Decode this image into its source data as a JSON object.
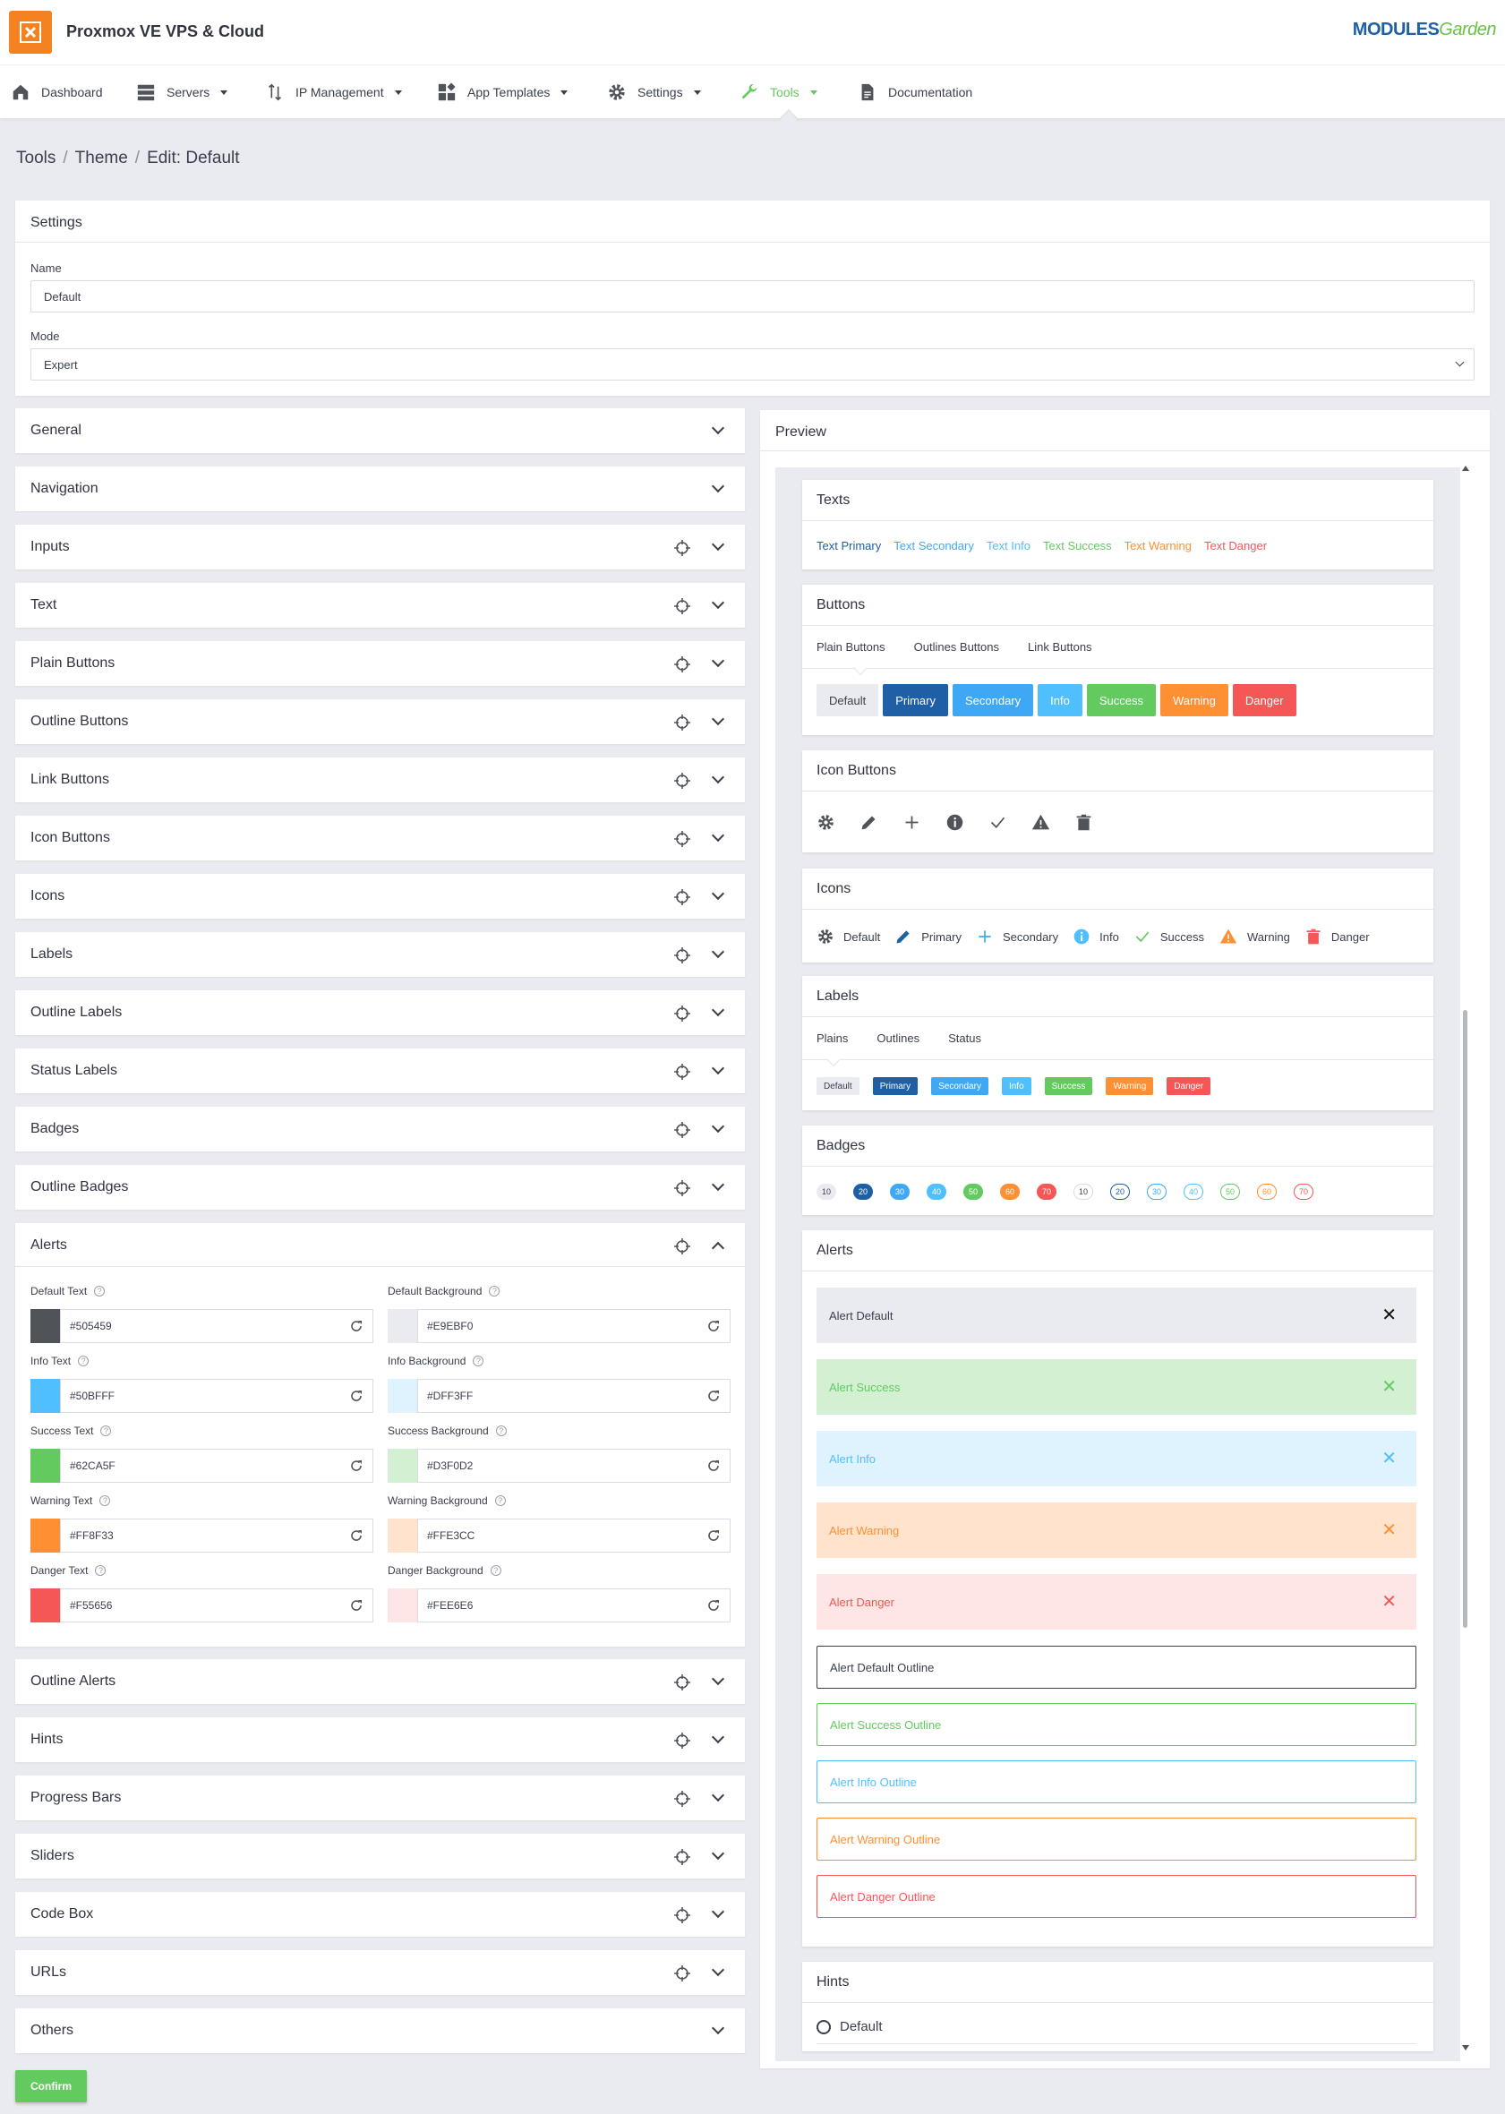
{
  "app": {
    "title": "Proxmox VE VPS & Cloud",
    "brand_a": "MODULES",
    "brand_b": "Garden"
  },
  "nav": [
    {
      "label": "Dashboard",
      "icon": "home-icon"
    },
    {
      "label": "Servers",
      "icon": "servers-icon"
    },
    {
      "label": "IP Management",
      "icon": "ip-arrows-icon"
    },
    {
      "label": "App Templates",
      "icon": "app-templates-icon"
    },
    {
      "label": "Settings",
      "icon": "gear-icon"
    },
    {
      "label": "Tools",
      "icon": "wrench-icon",
      "active": true
    },
    {
      "label": "Documentation",
      "icon": "document-icon"
    }
  ],
  "breadcrumb": [
    "Tools",
    "Theme",
    "Edit: Default"
  ],
  "settings": {
    "title": "Settings",
    "name_label": "Name",
    "name_value": "Default",
    "mode_label": "Mode",
    "mode_value": "Expert"
  },
  "sections": [
    "General",
    "Navigation",
    "Inputs",
    "Text",
    "Plain Buttons",
    "Outline Buttons",
    "Link Buttons",
    "Icon Buttons",
    "Icons",
    "Labels",
    "Outline Labels",
    "Status Labels",
    "Badges",
    "Outline Badges",
    "Alerts",
    "Outline Alerts",
    "Hints",
    "Progress Bars",
    "Sliders",
    "Code Box",
    "URLs",
    "Others"
  ],
  "alert_colors": [
    {
      "label": "Default Text",
      "value": "#505459"
    },
    {
      "label": "Default Background",
      "value": "#E9EBF0"
    },
    {
      "label": "Info Text",
      "value": "#50BFFF"
    },
    {
      "label": "Info Background",
      "value": "#DFF3FF"
    },
    {
      "label": "Success Text",
      "value": "#62CA5F"
    },
    {
      "label": "Success Background",
      "value": "#D3F0D2"
    },
    {
      "label": "Warning Text",
      "value": "#FF8F33"
    },
    {
      "label": "Warning Background",
      "value": "#FFE3CC"
    },
    {
      "label": "Danger Text",
      "value": "#F55656"
    },
    {
      "label": "Danger Background",
      "value": "#FEE6E6"
    }
  ],
  "preview": {
    "title": "Preview",
    "texts_title": "Texts",
    "texts": [
      "Text Primary",
      "Text Secondary",
      "Text Info",
      "Text Success",
      "Text Warning",
      "Text Danger"
    ],
    "buttons_title": "Buttons",
    "button_tabs": [
      "Plain Buttons",
      "Outlines Buttons",
      "Link Buttons"
    ],
    "buttons": [
      "Default",
      "Primary",
      "Secondary",
      "Info",
      "Success",
      "Warning",
      "Danger"
    ],
    "icon_buttons_title": "Icon Buttons",
    "icons_title": "Icons",
    "icons": [
      "Default",
      "Primary",
      "Secondary",
      "Info",
      "Success",
      "Warning",
      "Danger"
    ],
    "labels_title": "Labels",
    "label_tabs": [
      "Plains",
      "Outlines",
      "Status"
    ],
    "labels": [
      "Default",
      "Primary",
      "Secondary",
      "Info",
      "Success",
      "Warning",
      "Danger"
    ],
    "badges_title": "Badges",
    "badges": [
      "10",
      "20",
      "30",
      "40",
      "50",
      "60",
      "70"
    ],
    "alerts_title": "Alerts",
    "alerts": [
      "Alert Default",
      "Alert Success",
      "Alert Info",
      "Alert Warning",
      "Alert Danger"
    ],
    "outline_alerts": [
      "Alert Default Outline",
      "Alert Success Outline",
      "Alert Info Outline",
      "Alert Warning Outline",
      "Alert Danger Outline"
    ],
    "hints_title": "Hints",
    "hint_default": "Default"
  },
  "colors": {
    "default_bg": "#e9ebf0",
    "primary": "#1f5fa6",
    "secondary": "#3fa8f5",
    "info": "#50bfff",
    "success": "#62ca5f",
    "warning": "#ff8f33",
    "danger": "#f55656",
    "text_default": "#505459"
  },
  "confirm_label": "Confirm"
}
